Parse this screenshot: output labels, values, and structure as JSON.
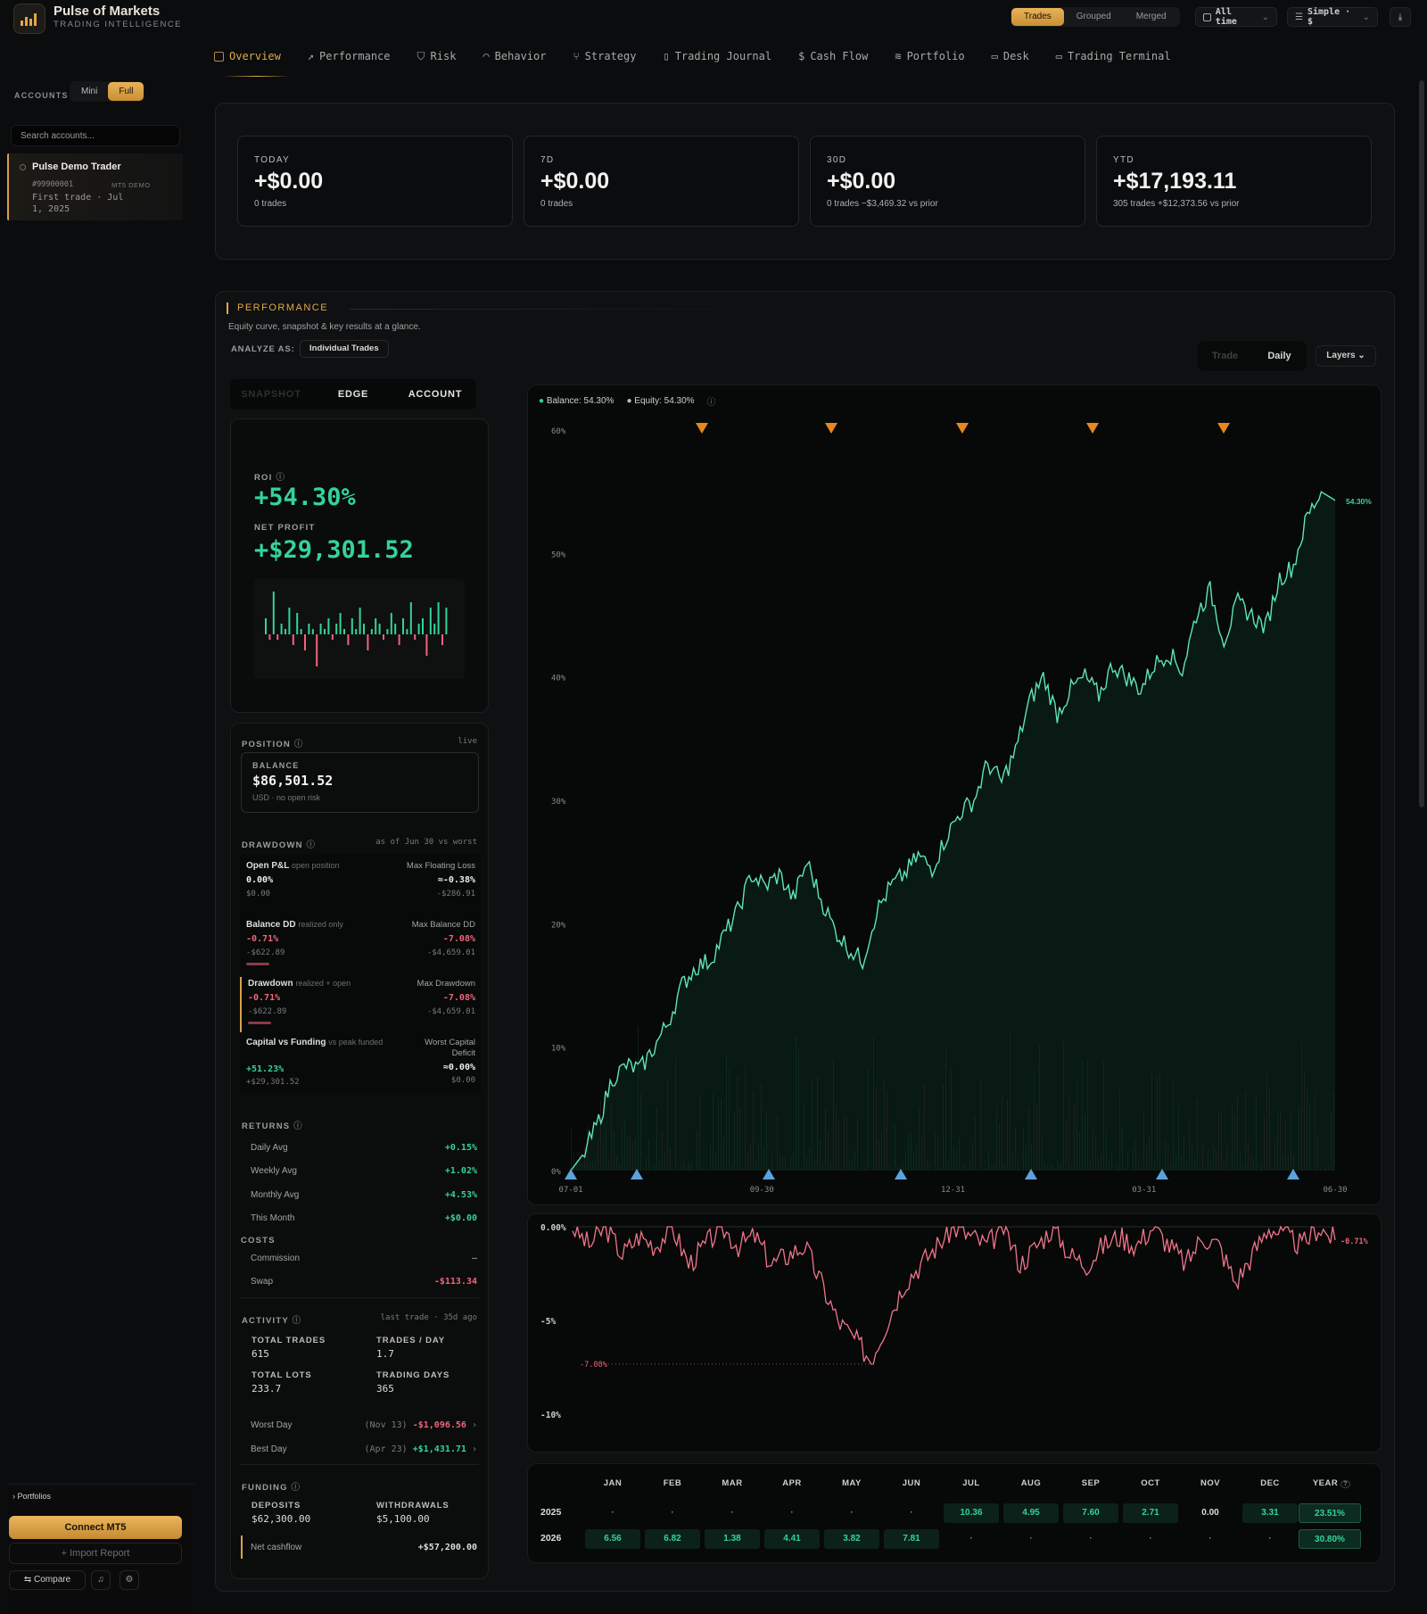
{
  "app": {
    "title": "Pulse of Markets",
    "subtitle": "TRADING INTELLIGENCE"
  },
  "topbar": {
    "modes": [
      "Trades",
      "Grouped",
      "Merged"
    ],
    "active_mode": "Trades",
    "range": "All time",
    "view": "Simple · $"
  },
  "nav": [
    {
      "label": "Overview",
      "active": true
    },
    {
      "label": "Performance"
    },
    {
      "label": "Risk"
    },
    {
      "label": "Behavior"
    },
    {
      "label": "Strategy"
    },
    {
      "label": "Trading Journal"
    },
    {
      "label": "Cash Flow"
    },
    {
      "label": "Portfolio"
    },
    {
      "label": "Desk"
    },
    {
      "label": "Trading Terminal"
    }
  ],
  "sidebar": {
    "accounts_label": "ACCOUNTS",
    "toggle": [
      "Mini",
      "Full"
    ],
    "toggle_active": "Full",
    "search_placeholder": "Search accounts...",
    "account": {
      "name": "Pulse Demo Trader",
      "id": "#99900001",
      "tag": "MT5 DEMO",
      "first_trade": "First trade · Jul 1, 2025"
    },
    "portfolios": "Portfolios",
    "connect": "Connect MT5",
    "import": "+ Import Report",
    "compare": "Compare"
  },
  "kpis": [
    {
      "label": "TODAY",
      "value": "+$0.00",
      "sub": "0 trades",
      "positive": false
    },
    {
      "label": "7D",
      "value": "+$0.00",
      "sub": "0 trades",
      "positive": false
    },
    {
      "label": "30D",
      "value": "+$0.00",
      "sub": "0 trades  −$3,469.32 vs prior",
      "positive": false
    },
    {
      "label": "YTD",
      "value": "+$17,193.11",
      "sub": "305 trades  +$12,373.56 vs prior",
      "positive": true
    }
  ],
  "performance": {
    "title": "PERFORMANCE",
    "subtitle": "Equity curve, snapshot & key results at a glance.",
    "analyze_label": "ANALYZE AS:",
    "analyze_value": "Individual Trades",
    "granularity": [
      "Trade",
      "Daily"
    ],
    "granularity_active": "Daily",
    "layers": "Layers",
    "tabs": [
      "SNAPSHOT",
      "EDGE",
      "ACCOUNT"
    ],
    "roi_label": "ROI",
    "roi": "+54.30%",
    "net_profit_label": "NET PROFIT",
    "net_profit": "+$29,301.52",
    "position": {
      "label": "POSITION",
      "status": "live",
      "balance_label": "BALANCE",
      "balance": "$86,501.52",
      "balance_sub": "USD · no open risk"
    },
    "drawdown": {
      "label": "DRAWDOWN",
      "note": "as of Jun 30 vs worst",
      "items": [
        {
          "title": "Open P&L",
          "hint": "open position",
          "value": "0.00%",
          "usd": "$0.00",
          "rtitle": "Max Floating Loss",
          "rvalue": "≈-0.38%",
          "rusd": "-$286.91",
          "vclass": "white"
        },
        {
          "title": "Balance DD",
          "hint": "realized only",
          "value": "-0.71%",
          "usd": "-$622.89",
          "rtitle": "Max Balance DD",
          "rvalue": "-7.08%",
          "rusd": "-$4,659.01",
          "vclass": "neg"
        },
        {
          "title": "Drawdown",
          "hint": "realized + open",
          "value": "-0.71%",
          "usd": "-$622.89",
          "rtitle": "Max Drawdown",
          "rvalue": "-7.08%",
          "rusd": "-$4,659.01",
          "vclass": "neg"
        },
        {
          "title": "Capital vs Funding",
          "hint": "vs peak funded",
          "value": "+51.23%",
          "usd": "+$29,301.52",
          "rtitle": "Worst Capital Deficit",
          "rvalue": "≈0.00%",
          "rusd": "$0.00",
          "vclass": "pos"
        }
      ]
    },
    "returns": {
      "label": "RETURNS",
      "items": [
        [
          "Daily Avg",
          "+0.15%"
        ],
        [
          "Weekly Avg",
          "+1.02%"
        ],
        [
          "Monthly Avg",
          "+4.53%"
        ],
        [
          "This Month",
          "+$0.00"
        ]
      ]
    },
    "costs": {
      "label": "COSTS",
      "items": [
        [
          "Commission",
          "—"
        ],
        [
          "Swap",
          "-$113.34"
        ]
      ]
    },
    "activity": {
      "label": "ACTIVITY",
      "note": "last trade · 35d ago",
      "cells": [
        [
          "TOTAL TRADES",
          "615"
        ],
        [
          "TRADES / DAY",
          "1.7"
        ],
        [
          "TOTAL LOTS",
          "233.7"
        ],
        [
          "TRADING DAYS",
          "365"
        ]
      ],
      "worst_day": {
        "label": "Worst Day",
        "date": "(Nov 13)",
        "value": "-$1,096.56"
      },
      "best_day": {
        "label": "Best Day",
        "date": "(Apr 23)",
        "value": "+$1,431.71"
      }
    },
    "funding": {
      "label": "FUNDING",
      "deposits_label": "DEPOSITS",
      "deposits": "$62,300.00",
      "withdrawals_label": "WITHDRAWALS",
      "withdrawals": "$5,100.00",
      "net_label": "Net cashflow",
      "net": "+$57,200.00"
    }
  },
  "legend": {
    "balance": "Balance: 54.30%",
    "equity": "Equity: 54.30%"
  },
  "chart_data": [
    {
      "type": "line",
      "y_unit": "%",
      "ylim": [
        0,
        60
      ],
      "yticks": [
        "60%",
        "50%",
        "40%",
        "30%",
        "20%",
        "10%",
        "0%"
      ],
      "xticks": [
        "07-01",
        "09-30",
        "12-31",
        "03-31",
        "06-30"
      ],
      "end_label": "54.30%",
      "series": [
        {
          "name": "Balance",
          "values": [
            0,
            1.5,
            4,
            7.5,
            8.5,
            8.2,
            10,
            12,
            15,
            16.5,
            17,
            19,
            21,
            24,
            23,
            24,
            22,
            25,
            22,
            19.5,
            18,
            17,
            21,
            23,
            24,
            25.5,
            24.5,
            27,
            29,
            30,
            33,
            31.5,
            34,
            38,
            40,
            37,
            39,
            40,
            38.5,
            41,
            40,
            39,
            41,
            42,
            40.5,
            45,
            47,
            43,
            46,
            45,
            44,
            48,
            49,
            53,
            55,
            54.3
          ]
        }
      ]
    },
    {
      "type": "line",
      "y_unit": "%",
      "ylim": [
        -10,
        0
      ],
      "yticks": [
        "0.00%",
        "-5%",
        "-10%"
      ],
      "min_label": "-7.08%",
      "end_label": "-0.71%",
      "series": [
        {
          "name": "Drawdown",
          "values": [
            0,
            -1,
            0,
            -1.5,
            -0.5,
            -1,
            0,
            -2,
            -1,
            0,
            -1,
            -0.5,
            -2,
            -1.5,
            -1,
            -3,
            -5,
            -6,
            -7.08,
            -5,
            -3,
            -2,
            -1,
            0,
            -0.5,
            -1,
            0,
            -2,
            -1,
            0,
            -1.5,
            -2,
            -1,
            -0.5,
            -1,
            0,
            -1,
            -2,
            -0.5,
            -1,
            -3,
            -1.5,
            0,
            -0.5,
            -1,
            0,
            -0.71
          ]
        }
      ]
    },
    {
      "type": "table",
      "columns": [
        "JAN",
        "FEB",
        "MAR",
        "APR",
        "MAY",
        "JUN",
        "JUL",
        "AUG",
        "SEP",
        "OCT",
        "NOV",
        "DEC",
        "YEAR"
      ],
      "rows": [
        {
          "year": "2025",
          "values": [
            "·",
            "·",
            "·",
            "·",
            "·",
            "·",
            "10.36",
            "4.95",
            "7.60",
            "2.71",
            "0.00",
            "3.31",
            "23.51%"
          ]
        },
        {
          "year": "2026",
          "values": [
            "6.56",
            "6.82",
            "1.38",
            "4.41",
            "3.82",
            "7.81",
            "·",
            "·",
            "·",
            "·",
            "·",
            "·",
            "30.80%"
          ]
        }
      ]
    }
  ],
  "colors": {
    "accent": "#e0a84a",
    "positive": "#34d399",
    "negative": "#f0657a"
  }
}
